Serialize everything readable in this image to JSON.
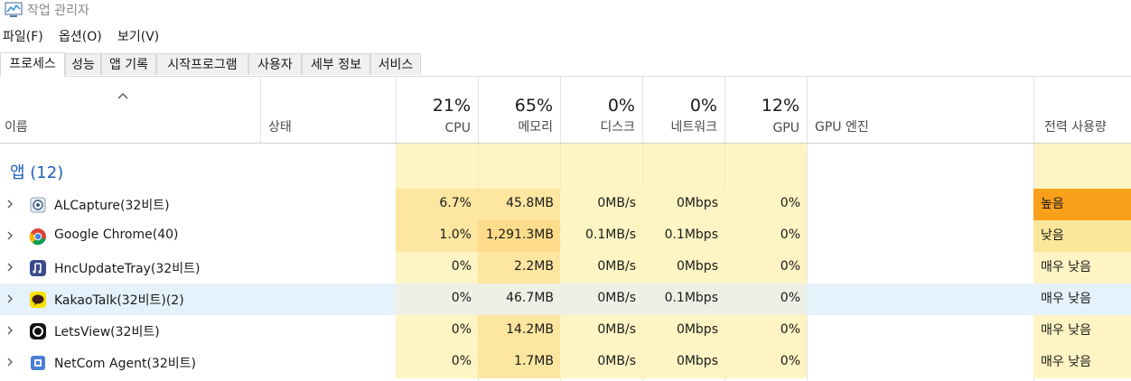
{
  "window": {
    "title": "작업 관리자"
  },
  "menu": [
    "파일(F)",
    "옵션(O)",
    "보기(V)"
  ],
  "tabs": [
    "프로세스",
    "성능",
    "앱 기록",
    "시작프로그램",
    "사용자",
    "세부 정보",
    "서비스"
  ],
  "columns": {
    "name": "이름",
    "status": "상태",
    "cpu": {
      "pct": "21%",
      "label": "CPU"
    },
    "memory": {
      "pct": "65%",
      "label": "메모리"
    },
    "disk": {
      "pct": "0%",
      "label": "디스크"
    },
    "network": {
      "pct": "0%",
      "label": "네트워크"
    },
    "gpu": {
      "pct": "12%",
      "label": "GPU"
    },
    "gpu_engine": "GPU 엔진",
    "power": "전력 사용량"
  },
  "group": {
    "label": "앱 (12)"
  },
  "rows": [
    {
      "name": "ALCapture(32비트)",
      "icon": "alcapture-icon",
      "cpu": "6.7%",
      "memory": "45.8MB",
      "disk": "0MB/s",
      "network": "0Mbps",
      "gpu": "0%",
      "power": "높음"
    },
    {
      "name": "Google Chrome(40)",
      "icon": "chrome-icon",
      "cpu": "1.0%",
      "memory": "1,291.3MB",
      "disk": "0.1MB/s",
      "network": "0.1Mbps",
      "gpu": "0%",
      "power": "낮음"
    },
    {
      "name": "HncUpdateTray(32비트)",
      "icon": "hnc-update-icon",
      "cpu": "0%",
      "memory": "2.2MB",
      "disk": "0MB/s",
      "network": "0Mbps",
      "gpu": "0%",
      "power": "매우 낮음"
    },
    {
      "name": "KakaoTalk(32비트)(2)",
      "icon": "kakaotalk-icon",
      "cpu": "0%",
      "memory": "46.7MB",
      "disk": "0MB/s",
      "network": "0.1Mbps",
      "gpu": "0%",
      "power": "매우 낮음"
    },
    {
      "name": "LetsView(32비트)",
      "icon": "letsview-icon",
      "cpu": "0%",
      "memory": "14.2MB",
      "disk": "0MB/s",
      "network": "0Mbps",
      "gpu": "0%",
      "power": "매우 낮음"
    },
    {
      "name": "NetCom Agent(32비트)",
      "icon": "netcom-agent-icon",
      "cpu": "0%",
      "memory": "1.7MB",
      "disk": "0MB/s",
      "network": "0Mbps",
      "gpu": "0%",
      "power": "매우 낮음"
    }
  ],
  "colors": {
    "heat_light": "#fff4c4",
    "heat_medium": "#ffe8a0",
    "heat_strong": "#fde08c",
    "power_high": "#f9a01b",
    "power_low": "#fbe79b",
    "power_very_low": "#fff4c4",
    "group_text": "#1e5fb5",
    "selection": "#e5f1fb"
  }
}
